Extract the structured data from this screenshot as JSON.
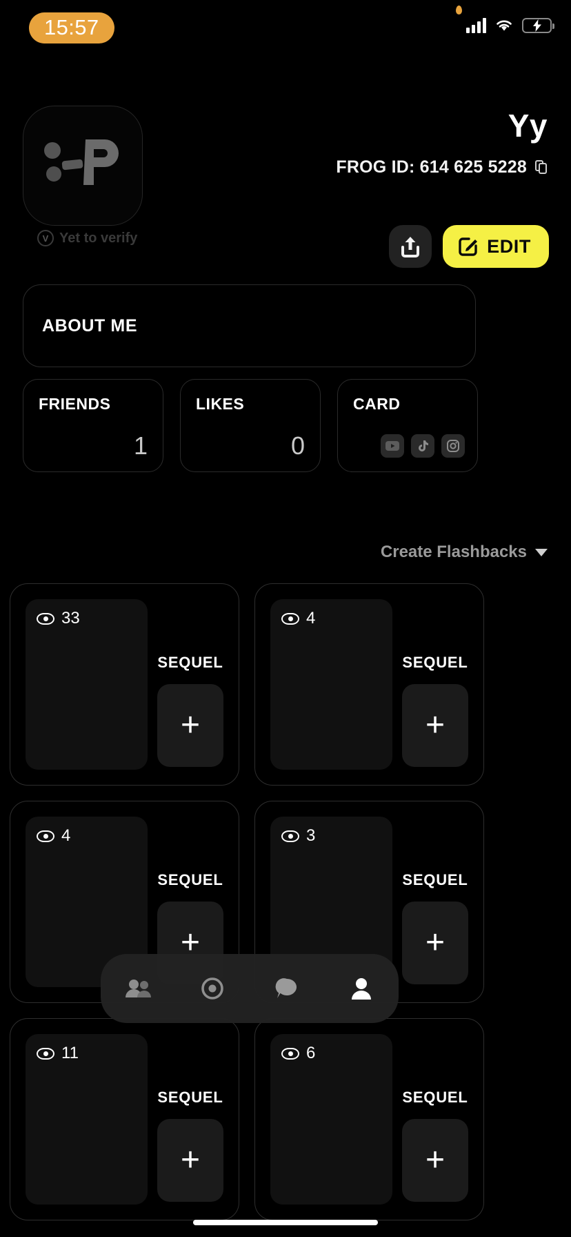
{
  "status_bar": {
    "time": "15:57",
    "icons": [
      "signal-bars-icon",
      "wifi-icon",
      "battery-charging-icon"
    ],
    "time_pill_color": "#E8A33D",
    "battery_fill_color": "#F2E14C"
  },
  "profile": {
    "avatar_icon": "frog-p-logo",
    "verify_text": "Yet to verify",
    "verify_badge_glyph": "V",
    "display_name": "Yy",
    "frog_id_label": "FROG ID: 614 625 5228",
    "copy_icon": "copy-icon",
    "share_icon": "share-upload-icon",
    "edit_label": "EDIT",
    "edit_icon": "pencil-square-icon",
    "edit_bg_color": "#F5F045"
  },
  "about": {
    "title": "ABOUT ME"
  },
  "stats": [
    {
      "label": "FRIENDS",
      "value": "1",
      "type": "number"
    },
    {
      "label": "LIKES",
      "value": "0",
      "type": "number"
    },
    {
      "label": "CARD",
      "value": "",
      "type": "socials",
      "socials": [
        "youtube-icon",
        "tiktok-icon",
        "instagram-icon"
      ]
    }
  ],
  "flashbacks_header": {
    "label": "Create Flashbacks",
    "chevron": "chevron-down-icon"
  },
  "flashback_cards": [
    {
      "views": "33",
      "sequel_label": "SEQUEL",
      "add_glyph": "+"
    },
    {
      "views": "4",
      "sequel_label": "SEQUEL",
      "add_glyph": "+"
    },
    {
      "views": "4",
      "sequel_label": "SEQUEL",
      "add_glyph": "+"
    },
    {
      "views": "3",
      "sequel_label": "SEQUEL",
      "add_glyph": "+"
    },
    {
      "views": "11",
      "sequel_label": "SEQUEL",
      "add_glyph": "+"
    },
    {
      "views": "6",
      "sequel_label": "SEQUEL",
      "add_glyph": "+"
    }
  ],
  "bottom_nav": [
    {
      "icon": "friends-icon",
      "active": false
    },
    {
      "icon": "camera-record-icon",
      "active": false
    },
    {
      "icon": "chat-bubble-icon",
      "active": false
    },
    {
      "icon": "profile-person-icon",
      "active": true
    }
  ]
}
